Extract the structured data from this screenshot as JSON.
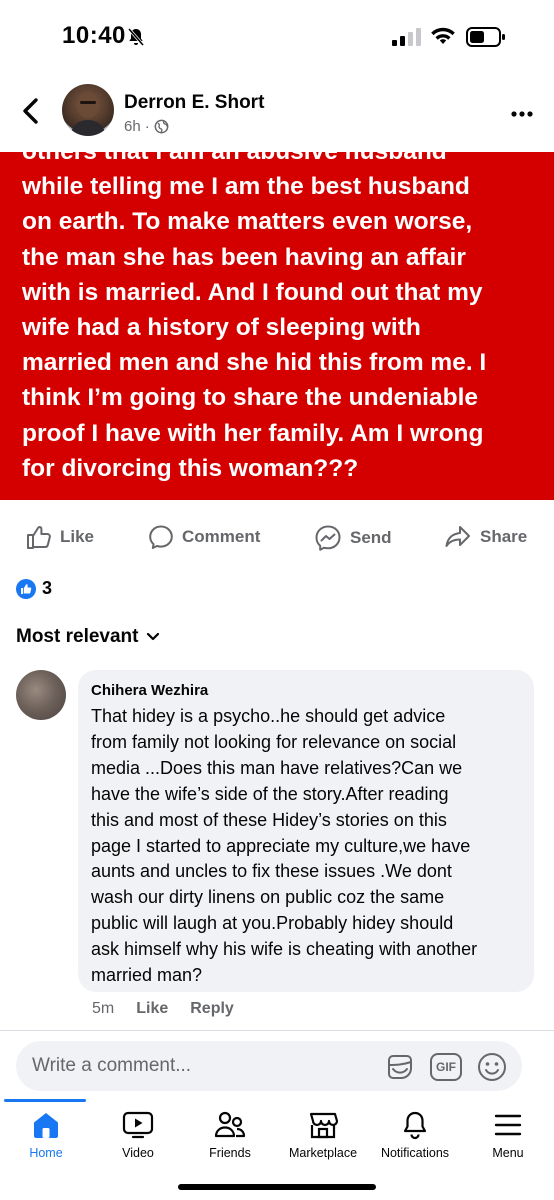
{
  "status_bar": {
    "time": "10:40"
  },
  "post": {
    "author": "Derron E. Short",
    "time": "6h",
    "image_text_lines": [
      "others that I am an abusive husband",
      "while telling me I am the best husband",
      "on earth. To make matters even worse,",
      "the man she has been having an affair",
      "with is married. And I found out that my",
      "wife had a history of sleeping with",
      "married men and she hid this from me. I",
      "think I’m going to share the undeniable",
      "proof I have with her family. Am I wrong",
      "for divorcing this woman???"
    ],
    "actions": {
      "like": "Like",
      "comment": "Comment",
      "send": "Send",
      "share": "Share"
    },
    "reaction_count": "3"
  },
  "comments_sort": "Most relevant",
  "comment": {
    "author": "Chihera Wezhira",
    "lines": [
      "That hidey is a psycho..he should get advice",
      "from family not looking for relevance on social",
      "media ...Does this man have relatives?Can we",
      "have the wife’s side of the story.After reading",
      "this and most of these Hidey’s stories on this",
      "page I started to appreciate my culture,we have",
      "aunts and uncles to fix these issues .We dont",
      "wash our dirty linens on public coz the same",
      "public will laugh at you.Probably hidey should",
      "ask himself why his wife is cheating with another",
      "married man?"
    ],
    "time": "5m",
    "like": "Like",
    "reply": "Reply"
  },
  "composer": {
    "placeholder": "Write a comment...",
    "gif_label": "GIF"
  },
  "tabs": [
    {
      "label": "Home",
      "icon": "home-icon"
    },
    {
      "label": "Video",
      "icon": "video-icon"
    },
    {
      "label": "Friends",
      "icon": "friends-icon"
    },
    {
      "label": "Marketplace",
      "icon": "marketplace-icon"
    },
    {
      "label": "Notifications",
      "icon": "bell-icon"
    },
    {
      "label": "Menu",
      "icon": "menu-icon"
    }
  ],
  "colors": {
    "accent": "#1877f2",
    "post_background": "#d40000",
    "secondary_text": "#65676b"
  }
}
